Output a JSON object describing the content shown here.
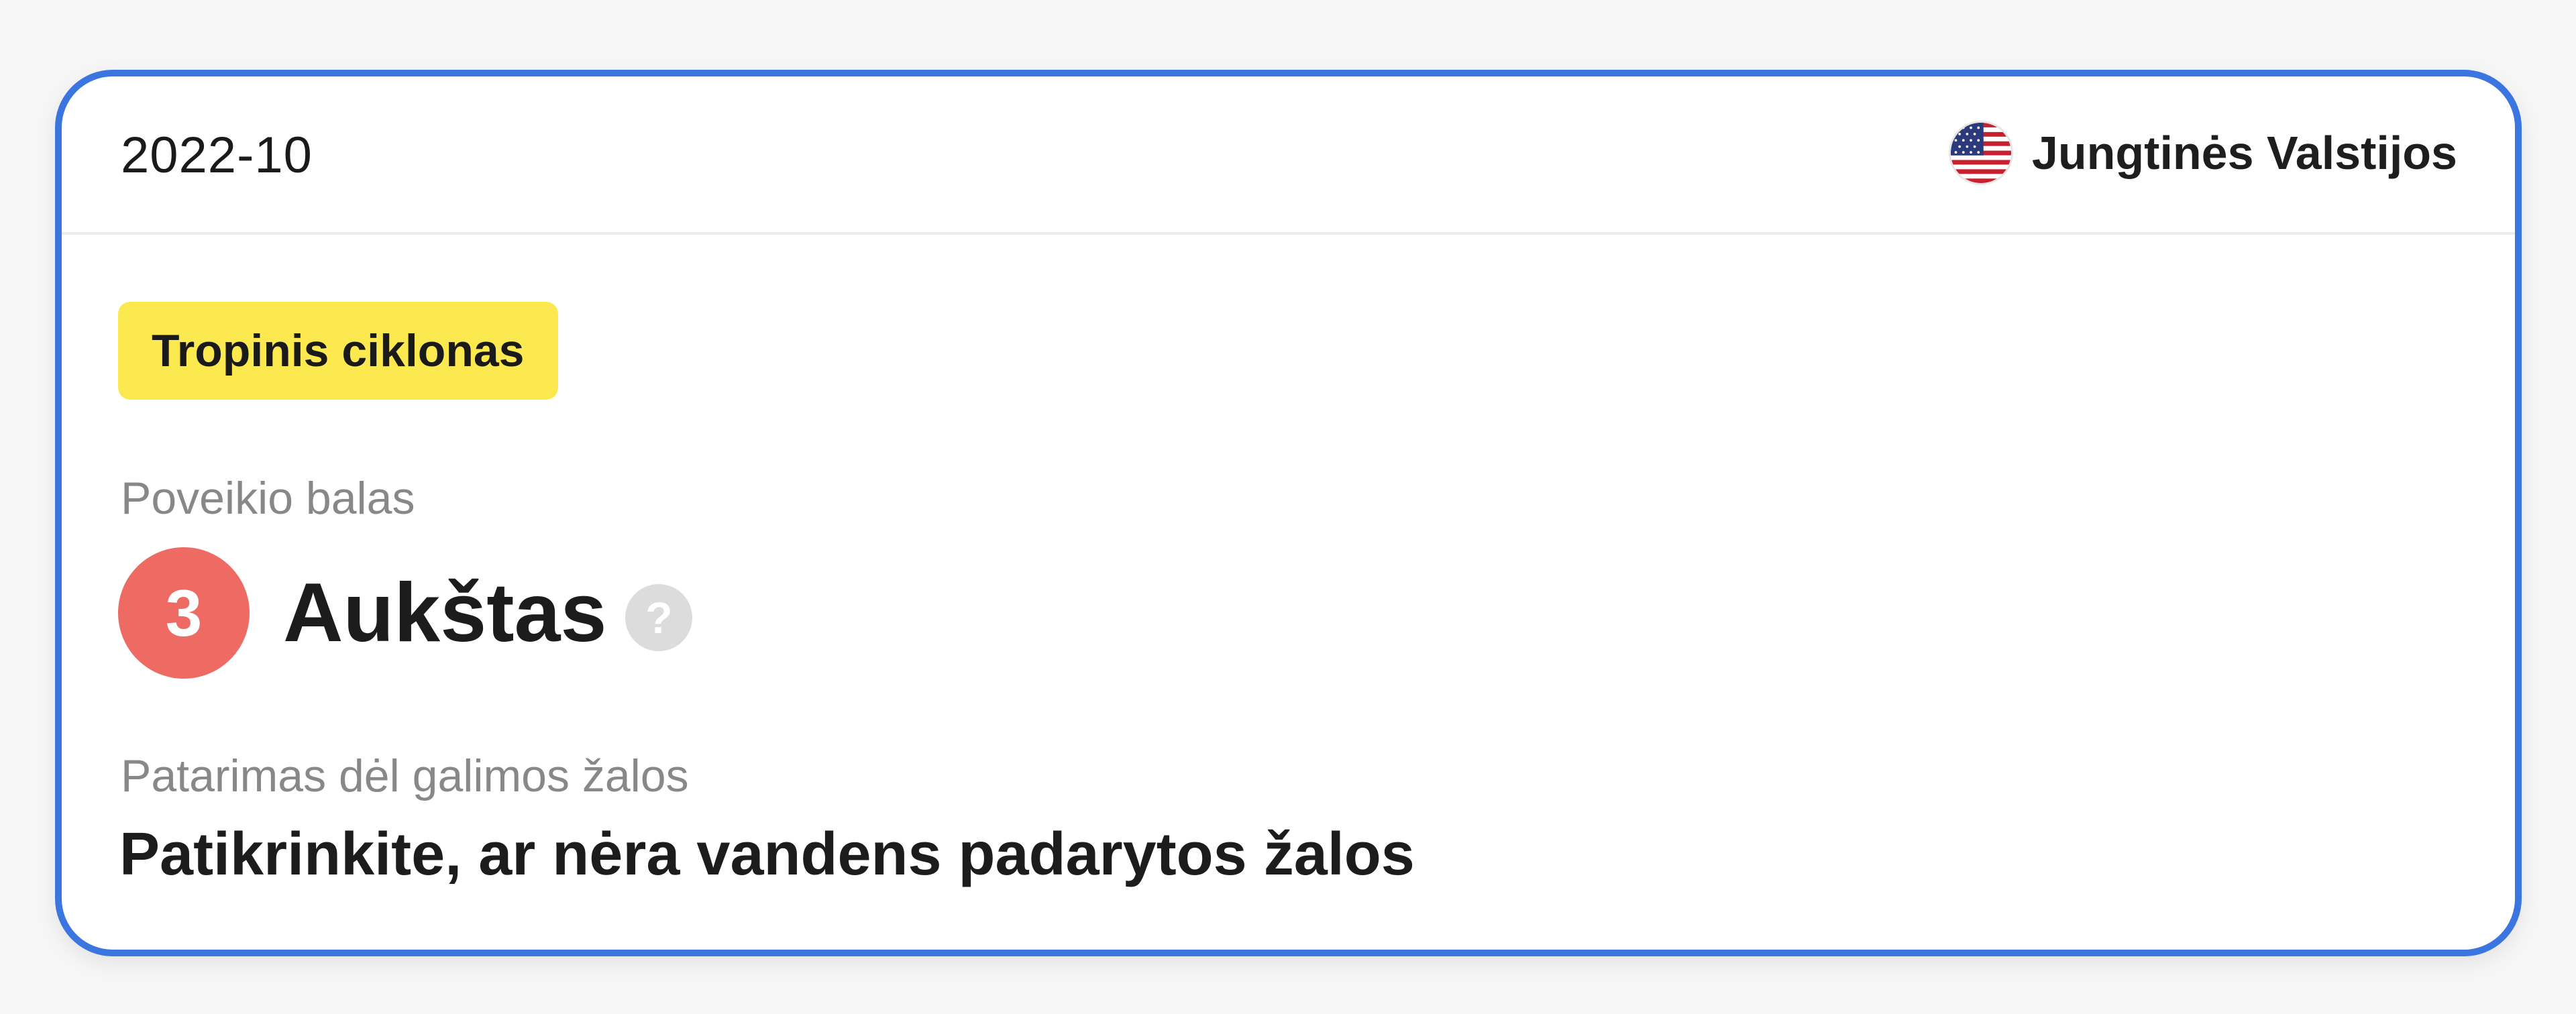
{
  "card": {
    "date": "2022-10",
    "country": {
      "name": "Jungtinės Valstijos",
      "flag_icon": "us-flag-icon"
    },
    "event_type": "Tropinis ciklonas",
    "impact": {
      "label": "Poveikio balas",
      "score": "3",
      "level": "Aukštas",
      "help_icon": "?"
    },
    "advice": {
      "label": "Patarimas dėl galimos žalos",
      "text": "Patikrinkite, ar nėra vandens padarytos žalos"
    }
  },
  "colors": {
    "border": "#3a75e0",
    "badge": "#fbe94f",
    "score_circle": "#ee6b64",
    "help_icon": "#dcdcdc"
  }
}
